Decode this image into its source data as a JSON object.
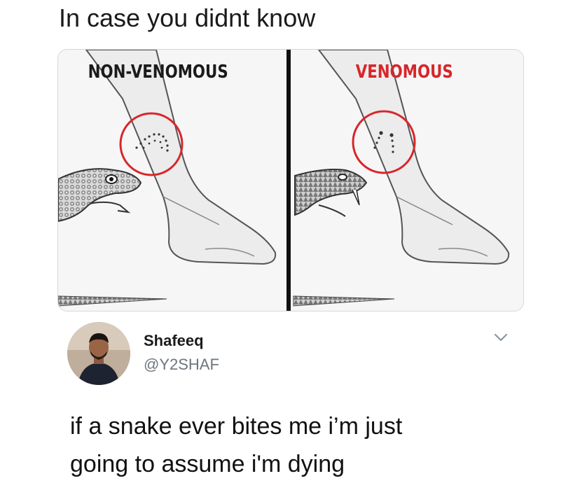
{
  "caption": "In case you didnt know",
  "panels": [
    {
      "label": "NON-VENOMOUS"
    },
    {
      "label": "VENOMOUS"
    }
  ],
  "user": {
    "name": "Shafeeq",
    "handle": "@Y2SHAF"
  },
  "tweet": {
    "line1": "if a snake ever bites me i’m just",
    "line2": "going to assume i'm dying"
  },
  "icons": {
    "more": "chevron-down-icon"
  }
}
